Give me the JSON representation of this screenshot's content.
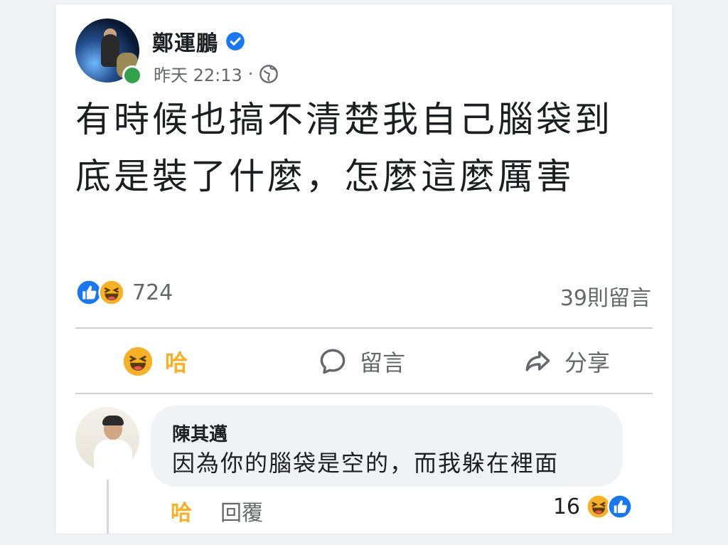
{
  "post": {
    "author": "鄭運鵬",
    "timestamp": "昨天 22:13",
    "separator": "·",
    "text": "有時候也搞不清楚我自己腦袋到底是裝了什麼，怎麼這麼厲害",
    "reaction_count": "724",
    "reaction_icons": [
      "like-icon",
      "haha-icon"
    ],
    "comments_count": "39則留言"
  },
  "actions": {
    "haha_label": "哈",
    "comment_label": "留言",
    "share_label": "分享"
  },
  "comment": {
    "author": "陳其邁",
    "text": "因為你的腦袋是空的，而我躲在裡面",
    "like_label": "哈",
    "reply_label": "回覆",
    "reaction_count": "16",
    "reaction_icons": [
      "haha-icon",
      "like-icon"
    ]
  },
  "colors": {
    "facebook_blue": "#1877f2",
    "haha_yellow": "#f7b125",
    "online_green": "#31a24c",
    "secondary_text": "#65676b"
  }
}
